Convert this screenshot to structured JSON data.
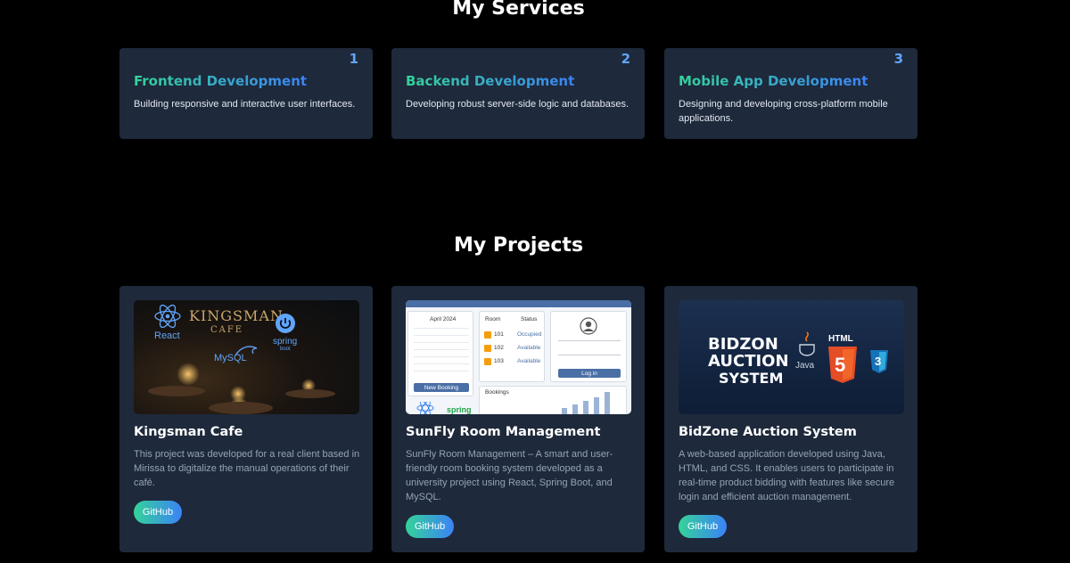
{
  "services": {
    "title": "My Services",
    "items": [
      {
        "number": "1",
        "title": "Frontend Development",
        "description": "Building responsive and interactive user interfaces."
      },
      {
        "number": "2",
        "title": "Backend Development",
        "description": "Developing robust server-side logic and databases."
      },
      {
        "number": "3",
        "title": "Mobile App Development",
        "description": "Designing and developing cross-platform mobile applications."
      }
    ]
  },
  "projects": {
    "title": "My Projects",
    "items": [
      {
        "title": "Kingsman Cafe",
        "description": "This project was developed for a real client based in Mirissa to digitalize the manual operations of their café.",
        "button": "GitHub",
        "thumb": {
          "name": "KINGSMAN",
          "sub": "CAFE",
          "tech": [
            "React",
            "spring",
            "boot",
            "MySQL"
          ]
        }
      },
      {
        "title": "SunFly Room Management",
        "description": "SunFly Room Management – A smart and user-friendly room booking system developed as a university project using React, Spring Boot, and MySQL.",
        "button": "GitHub",
        "thumb": {
          "month": "April 2024",
          "room_header": "Room",
          "status_header": "Status",
          "rooms": [
            {
              "room": "101",
              "status": "Occupied"
            },
            {
              "room": "102",
              "status": "Available"
            },
            {
              "room": "103",
              "status": "Available"
            }
          ],
          "new_booking": "New Booking",
          "login": "Log in",
          "bookings": "Bookings",
          "spring": "spring"
        }
      },
      {
        "title": "BidZone Auction System",
        "description": "A web-based application developed using Java, HTML, and CSS. It enables users to participate in real-time product bidding with features like secure login and efficient auction management.",
        "button": "GitHub",
        "thumb": {
          "line1": "BIDZON",
          "line2": "AUCTION",
          "line3": "SYSTEM",
          "java": "Java",
          "html": "HTML",
          "html_num": "5",
          "css_num": "3"
        }
      }
    ]
  },
  "colors": {
    "background": "#000000",
    "card": "#1e293b",
    "accent_number": "#60a5fa",
    "gradient_start": "#34d399",
    "gradient_end": "#3b82f6",
    "muted_text": "#94a3b8"
  }
}
